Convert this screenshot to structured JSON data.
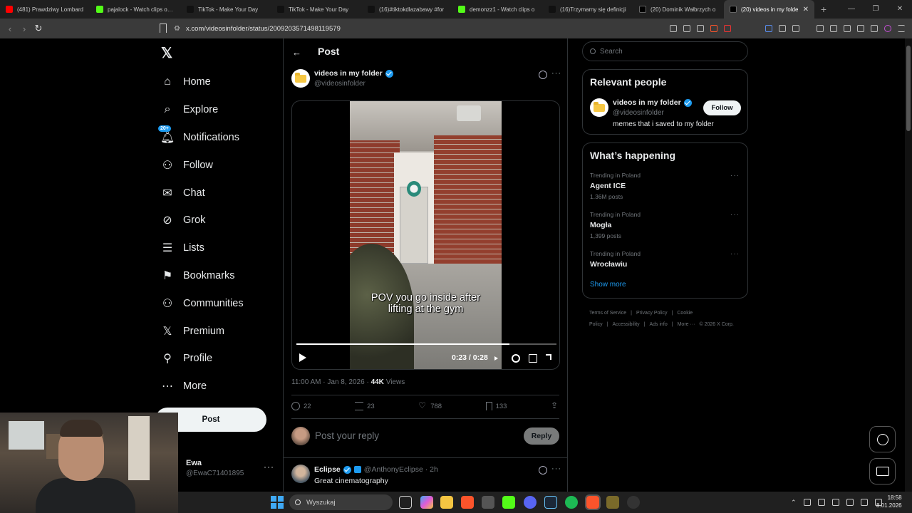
{
  "browser": {
    "tabs": [
      {
        "title": "(481) Prawdziwy Lombard",
        "icon": "youtube-icon",
        "color": "#ff0000",
        "active": false
      },
      {
        "title": "pajalock - Watch clips on K",
        "icon": "kick-icon",
        "color": "#53fc18",
        "active": false
      },
      {
        "title": "TikTok - Make Your Day",
        "icon": "tiktok-icon",
        "color": "#111111",
        "active": false
      },
      {
        "title": "TikTok - Make Your Day",
        "icon": "tiktok-icon",
        "color": "#111111",
        "active": false
      },
      {
        "title": "(16)#tiktokdlazabawy #for",
        "icon": "tiktok-icon",
        "color": "#111111",
        "active": false
      },
      {
        "title": "demonzz1 - Watch clips o",
        "icon": "kick-icon",
        "color": "#53fc18",
        "active": false
      },
      {
        "title": "(16)Trzymamy się definicji",
        "icon": "tiktok-icon",
        "color": "#111111",
        "active": false
      },
      {
        "title": "(20) Dominik Wałbrzych o",
        "icon": "x-icon",
        "color": "#000000",
        "active": false
      },
      {
        "title": "(20) videos in my folde",
        "icon": "x-icon",
        "color": "#000000",
        "active": true
      }
    ],
    "url": "x.com/videosinfolder/status/2009203571498119579",
    "close_glyph": "✕",
    "new_tab_glyph": "+"
  },
  "nav": {
    "logo": "𝕏",
    "items": [
      {
        "label": "Home",
        "icon": "home-icon"
      },
      {
        "label": "Explore",
        "icon": "search-icon"
      },
      {
        "label": "Notifications",
        "icon": "bell-icon",
        "badge": "20+"
      },
      {
        "label": "Follow",
        "icon": "add-person-icon"
      },
      {
        "label": "Chat",
        "icon": "mail-icon"
      },
      {
        "label": "Grok",
        "icon": "grok-icon"
      },
      {
        "label": "Lists",
        "icon": "list-icon"
      },
      {
        "label": "Bookmarks",
        "icon": "bookmark-icon"
      },
      {
        "label": "Communities",
        "icon": "communities-icon"
      },
      {
        "label": "Premium",
        "icon": "x-icon"
      },
      {
        "label": "Profile",
        "icon": "person-icon"
      },
      {
        "label": "More",
        "icon": "more-circle-icon"
      }
    ],
    "post_button": "Post",
    "account": {
      "name": "Ewa",
      "handle": "@EwaC71401895"
    }
  },
  "post": {
    "header_title": "Post",
    "author": {
      "name": "videos in my folder",
      "handle": "@videosinfolder"
    },
    "video": {
      "caption_line1": "POV you go inside after",
      "caption_line2": "lifting at the gym",
      "time": "0:23 / 0:28",
      "progress": 0.82
    },
    "timestamp": "11:00 AM · Jan 8, 2026 · ",
    "views_count": "44K",
    "views_label": " Views",
    "stats": {
      "replies": "22",
      "reposts": "23",
      "likes": "788",
      "bookmarks": "133"
    },
    "reply_placeholder": "Post your reply",
    "reply_button": "Reply"
  },
  "comment": {
    "name": "Eclipse",
    "handle": "@AnthonyEclipse · 2h",
    "text": "Great cinematography"
  },
  "sidebar": {
    "search_placeholder": "Search",
    "relevant": {
      "title": "Relevant people",
      "name": "videos in my folder",
      "handle": "@videosinfolder",
      "bio": "memes that i saved to my folder",
      "follow": "Follow"
    },
    "happening": {
      "title": "What’s happening",
      "trends": [
        {
          "context": "Trending in Poland",
          "topic": "Agent ICE",
          "count": "1.36M posts"
        },
        {
          "context": "Trending in Poland",
          "topic": "Mogła",
          "count": "1,399 posts"
        },
        {
          "context": "Trending in Poland",
          "topic": "Wrocławiu",
          "count": ""
        }
      ],
      "show_more": "Show more"
    },
    "footer": [
      "Terms of Service",
      "|",
      "Privacy Policy",
      "|",
      "Cookie Policy",
      "|",
      "Accessibility",
      "|",
      "Ads info",
      "|",
      "More ···",
      "© 2026 X Corp."
    ]
  },
  "taskbar": {
    "search": "Wyszukaj",
    "time": "18:58",
    "date": "8.01.2026"
  }
}
